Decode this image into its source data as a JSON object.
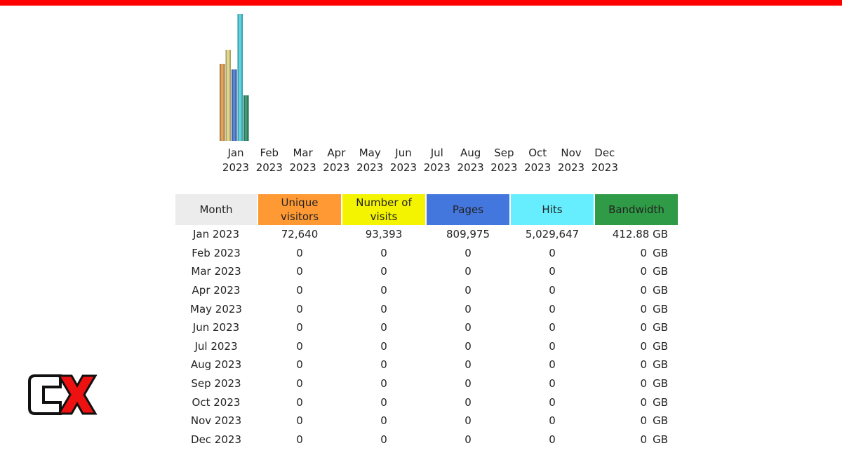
{
  "colors": {
    "top_bar": "#ff0000",
    "header_month": "#ececec",
    "header_unique": "#ff9933",
    "header_visits": "#f4f400",
    "header_pages": "#4477dd",
    "header_hits": "#66eeff",
    "header_bandwidth": "#2f9b46",
    "bar_unique": "#e69a3c",
    "bar_visits": "#e8dc7c",
    "bar_pages": "#3a6fd6",
    "bar_hits": "#3ed6e4",
    "bar_bandwidth": "#178a5c"
  },
  "chart_data": {
    "type": "bar",
    "categories": [
      [
        "Jan",
        "2023"
      ],
      [
        "Feb",
        "2023"
      ],
      [
        "Mar",
        "2023"
      ],
      [
        "Apr",
        "2023"
      ],
      [
        "May",
        "2023"
      ],
      [
        "Jun",
        "2023"
      ],
      [
        "Jul",
        "2023"
      ],
      [
        "Aug",
        "2023"
      ],
      [
        "Sep",
        "2023"
      ],
      [
        "Oct",
        "2023"
      ],
      [
        "Nov",
        "2023"
      ],
      [
        "Dec",
        "2023"
      ]
    ],
    "series": [
      {
        "key": "unique",
        "values": [
          72640,
          0,
          0,
          0,
          0,
          0,
          0,
          0,
          0,
          0,
          0,
          0
        ]
      },
      {
        "key": "visits",
        "values": [
          93393,
          0,
          0,
          0,
          0,
          0,
          0,
          0,
          0,
          0,
          0,
          0
        ]
      },
      {
        "key": "pages",
        "values": [
          809975,
          0,
          0,
          0,
          0,
          0,
          0,
          0,
          0,
          0,
          0,
          0
        ]
      },
      {
        "key": "hits",
        "values": [
          5029647,
          0,
          0,
          0,
          0,
          0,
          0,
          0,
          0,
          0,
          0,
          0
        ]
      },
      {
        "key": "bandwidth",
        "values": [
          412.88,
          0,
          0,
          0,
          0,
          0,
          0,
          0,
          0,
          0,
          0,
          0
        ]
      }
    ]
  },
  "table": {
    "headers": {
      "month": "Month",
      "unique_line1": "Unique",
      "unique_line2": "visitors",
      "visits_line1": "Number of",
      "visits_line2": "visits",
      "pages": "Pages",
      "hits": "Hits",
      "bandwidth": "Bandwidth"
    },
    "rows": [
      {
        "month": "Jan 2023",
        "unique": "72,640",
        "visits": "93,393",
        "pages": "809,975",
        "hits": "5,029,647",
        "bandwidth": "412.88 GB"
      },
      {
        "month": "Feb 2023",
        "unique": "0",
        "visits": "0",
        "pages": "0",
        "hits": "0",
        "bw_value": "0",
        "bw_unit": "GB"
      },
      {
        "month": "Mar 2023",
        "unique": "0",
        "visits": "0",
        "pages": "0",
        "hits": "0",
        "bw_value": "0",
        "bw_unit": "GB"
      },
      {
        "month": "Apr 2023",
        "unique": "0",
        "visits": "0",
        "pages": "0",
        "hits": "0",
        "bw_value": "0",
        "bw_unit": "GB"
      },
      {
        "month": "May 2023",
        "unique": "0",
        "visits": "0",
        "pages": "0",
        "hits": "0",
        "bw_value": "0",
        "bw_unit": "GB"
      },
      {
        "month": "Jun 2023",
        "unique": "0",
        "visits": "0",
        "pages": "0",
        "hits": "0",
        "bw_value": "0",
        "bw_unit": "GB"
      },
      {
        "month": "Jul 2023",
        "unique": "0",
        "visits": "0",
        "pages": "0",
        "hits": "0",
        "bw_value": "0",
        "bw_unit": "GB"
      },
      {
        "month": "Aug 2023",
        "unique": "0",
        "visits": "0",
        "pages": "0",
        "hits": "0",
        "bw_value": "0",
        "bw_unit": "GB"
      },
      {
        "month": "Sep 2023",
        "unique": "0",
        "visits": "0",
        "pages": "0",
        "hits": "0",
        "bw_value": "0",
        "bw_unit": "GB"
      },
      {
        "month": "Oct 2023",
        "unique": "0",
        "visits": "0",
        "pages": "0",
        "hits": "0",
        "bw_value": "0",
        "bw_unit": "GB"
      },
      {
        "month": "Nov 2023",
        "unique": "0",
        "visits": "0",
        "pages": "0",
        "hits": "0",
        "bw_value": "0",
        "bw_unit": "GB"
      },
      {
        "month": "Dec 2023",
        "unique": "0",
        "visits": "0",
        "pages": "0",
        "hits": "0",
        "bw_value": "0",
        "bw_unit": "GB"
      }
    ]
  },
  "logo": {
    "icon": "cx-logo-icon",
    "text": "CX"
  }
}
